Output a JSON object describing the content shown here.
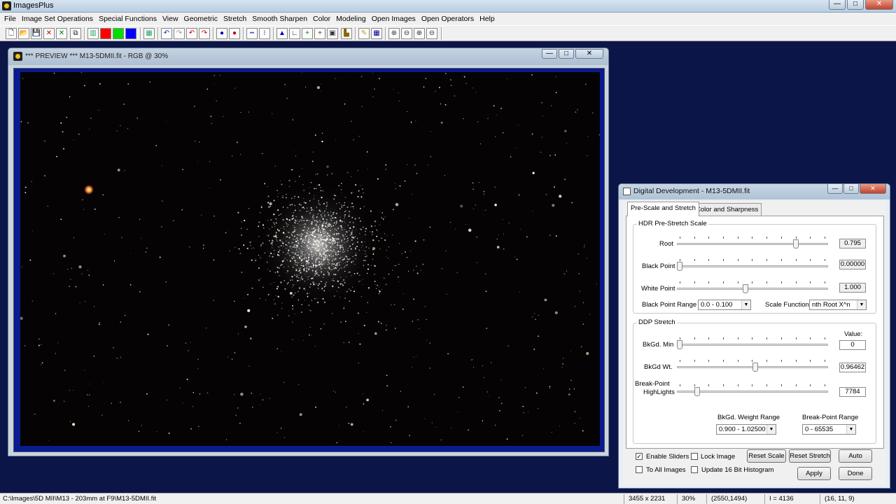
{
  "app": {
    "title": "ImagesPlus",
    "controls": {
      "minimize": "—",
      "maximize": "□",
      "close": "✕"
    }
  },
  "menu": [
    "File",
    "Image Set Operations",
    "Special Functions",
    "View",
    "Geometric",
    "Stretch",
    "Smooth Sharpen",
    "Color",
    "Modeling",
    "Open Images",
    "Open Operators",
    "Help"
  ],
  "toolbar": {
    "buttons": [
      {
        "icon": "new-file-icon",
        "glyph": "🗋",
        "color": ""
      },
      {
        "icon": "open-folder-icon",
        "glyph": "📂",
        "color": ""
      },
      {
        "icon": "save-disk-icon",
        "glyph": "💾",
        "color": ""
      },
      {
        "icon": "close-red-x-icon",
        "glyph": "✕",
        "color": "#cc0000"
      },
      {
        "icon": "close-green-x-icon",
        "glyph": "✕",
        "color": "#008000"
      },
      {
        "icon": "copy-window-icon",
        "glyph": "⧉",
        "color": ""
      },
      {
        "icon": "rgb-channels-icon",
        "glyph": "▥",
        "color": "#2a6"
      },
      {
        "icon": "red-channel-icon",
        "glyph": "",
        "color": "#ff0000"
      },
      {
        "icon": "green-channel-icon",
        "glyph": "",
        "color": "#00dd00"
      },
      {
        "icon": "blue-channel-icon",
        "glyph": "",
        "color": "#0000ff"
      },
      {
        "icon": "grid-view-icon",
        "glyph": "▦",
        "color": "#2a6"
      },
      {
        "icon": "undo-icon",
        "glyph": "↶",
        "color": "#0033cc"
      },
      {
        "icon": "redo-icon",
        "glyph": "↷",
        "color": "#999999"
      },
      {
        "icon": "undo-all-icon",
        "glyph": "↶",
        "color": "#cc0000"
      },
      {
        "icon": "redo-all-icon",
        "glyph": "↷",
        "color": "#cc0000"
      },
      {
        "icon": "blue-point-icon",
        "glyph": "●",
        "color": "#0000cc"
      },
      {
        "icon": "red-point-icon",
        "glyph": "●",
        "color": "#cc0000"
      },
      {
        "icon": "line-profile-icon",
        "glyph": "┅",
        "color": "#0000cc"
      },
      {
        "icon": "point-select-icon",
        "glyph": "⁝",
        "color": "#0000cc"
      },
      {
        "icon": "histogram-icon",
        "glyph": "▲",
        "color": "#0000cc"
      },
      {
        "icon": "axis-icon",
        "glyph": "∟",
        "color": "#333333"
      },
      {
        "icon": "add-crosshair-icon",
        "glyph": "+",
        "color": "#008000"
      },
      {
        "icon": "crosshair-icon",
        "glyph": "+",
        "color": "#333333"
      },
      {
        "icon": "frame-select-icon",
        "glyph": "▣",
        "color": "#333333"
      },
      {
        "icon": "image-info-icon",
        "glyph": "▙",
        "color": "#886600"
      },
      {
        "icon": "pencil-icon",
        "glyph": "✎",
        "color": "#cc9900"
      },
      {
        "icon": "table-grid-icon",
        "glyph": "▦",
        "color": "#000099"
      },
      {
        "icon": "zoom-in-icon",
        "glyph": "⊕",
        "color": "#333333"
      },
      {
        "icon": "zoom-out-icon",
        "glyph": "⊖",
        "color": "#333333"
      },
      {
        "icon": "zoom-fit-icon",
        "glyph": "⊕",
        "color": "#333333"
      },
      {
        "icon": "zoom-actual-icon",
        "glyph": "⊖",
        "color": "#333333"
      }
    ]
  },
  "preview": {
    "title": "*** PREVIEW *** M13-5DMII.fit - RGB @ 30%",
    "controls": {
      "minimize": "—",
      "maximize": "□",
      "close": "✕"
    }
  },
  "dialog": {
    "title": "Digital Development - M13-5DMII.fit",
    "controls": {
      "minimize": "—",
      "maximize": "□",
      "close": "✕"
    },
    "tabs": [
      "Pre-Scale and Stretch",
      "Color and Sharpness"
    ],
    "hdr": {
      "label": "HDR Pre-Stretch Scale",
      "root": {
        "label": "Root",
        "value": "0.795",
        "position": 0.8
      },
      "black_point": {
        "label": "Black Point",
        "value": "0.00000",
        "position": 0.0
      },
      "white_point": {
        "label": "White Point",
        "value": "1.000",
        "position": 0.45
      },
      "black_point_range": {
        "label": "Black Point Range",
        "selected": "0.0 - 0.100"
      },
      "scale_function": {
        "label": "Scale Function",
        "selected": "nth Root X^n"
      }
    },
    "ddp": {
      "label": "DDP Stretch",
      "value_header": "Value:",
      "bkgd_min": {
        "label": "BkGd. Min",
        "value": "0",
        "position": 0.0
      },
      "bkgd_wt": {
        "label": "BkGd Wt.",
        "value": "0.96462",
        "position": 0.52
      },
      "breakpoint": {
        "label_line1": "Break-Point",
        "label_line2": "HighLights",
        "value": "7784",
        "position": 0.12
      },
      "bkgd_weight_range": {
        "label": "BkGd. Weight Range",
        "selected": "0.900 - 1.02500"
      },
      "breakpoint_range": {
        "label": "Break-Point Range",
        "selected": "0 - 65535"
      }
    },
    "options": {
      "enable_sliders": "Enable Sliders",
      "lock_image": "Lock Image",
      "to_all_images": "To All Images",
      "update_16bit": "Update 16 Bit Histogram"
    },
    "buttons": {
      "reset_scale": "Reset Scale",
      "reset_stretch": "Reset Stretch",
      "auto": "Auto",
      "apply": "Apply",
      "done": "Done"
    }
  },
  "status": {
    "path": "C:\\Images\\5D MII\\M13 - 203mm at F9\\M13-5DMII.fit",
    "dims": "3455 x 2231",
    "zoom": "30%",
    "coords": "(2550,1494)",
    "intensity": "I = 4136",
    "rgb": "(16, 11, 9)"
  }
}
